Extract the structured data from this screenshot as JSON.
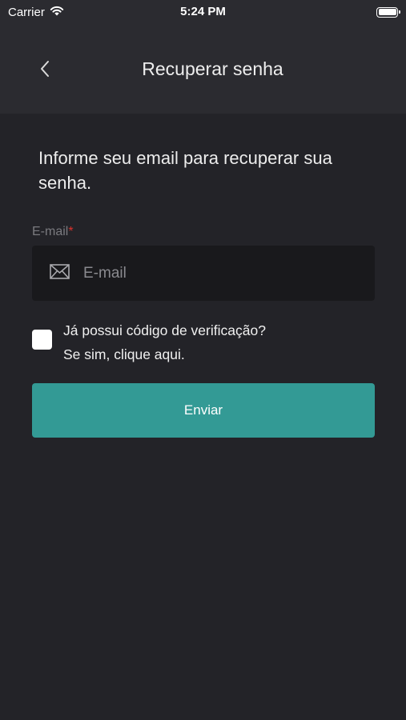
{
  "status_bar": {
    "carrier": "Carrier",
    "time": "5:24 PM",
    "battery_level": 1.0
  },
  "nav": {
    "title": "Recuperar senha",
    "back_icon": "chevron-left-icon"
  },
  "content": {
    "instructions": "Informe seu email para recuperar sua senha.",
    "email_label": "E-mail",
    "required_mark": "*",
    "email_placeholder": "E-mail",
    "email_value": "",
    "email_icon": "envelope-icon",
    "verification_line1": "Já possui código de verificação?",
    "verification_line2": "Se sim, clique aqui.",
    "verification_checked": false,
    "submit_label": "Enviar"
  },
  "colors": {
    "background": "#232328",
    "header": "#2b2b30",
    "field": "#19191c",
    "accent": "#339a95",
    "required": "#d9322d"
  }
}
